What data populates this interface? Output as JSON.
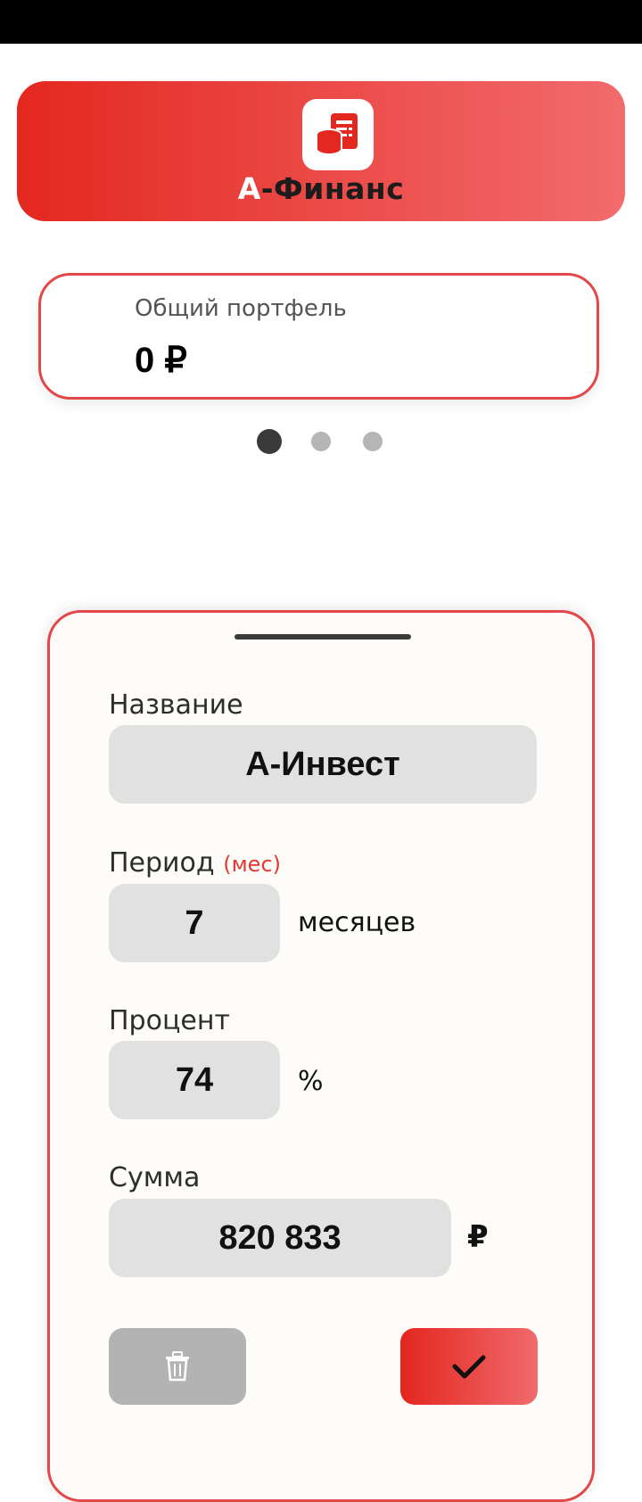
{
  "app": {
    "brand_prefix": "А",
    "brand_suffix": "-Финанс"
  },
  "portfolio": {
    "label": "Общий портфель",
    "value": "0 ₽"
  },
  "pager": {
    "pages": 3,
    "active": 1
  },
  "form": {
    "name_label": "Название",
    "name_value": "А-Инвест",
    "period_label": "Период",
    "period_unit_label": "(мес)",
    "period_value": "7",
    "period_suffix": "месяцев",
    "percent_label": "Процент",
    "percent_value": "74",
    "percent_suffix": "%",
    "amount_label": "Сумма",
    "amount_value": "820 833",
    "amount_suffix": "₽"
  },
  "buttons": {
    "delete_icon": "trash-icon",
    "confirm_icon": "checkmark-icon"
  },
  "colors": {
    "accent_red": "#e3281f",
    "accent_red_light": "#f26b6d",
    "input_bg": "#e1e1e1",
    "delete_button_bg": "#b3b3b3"
  }
}
